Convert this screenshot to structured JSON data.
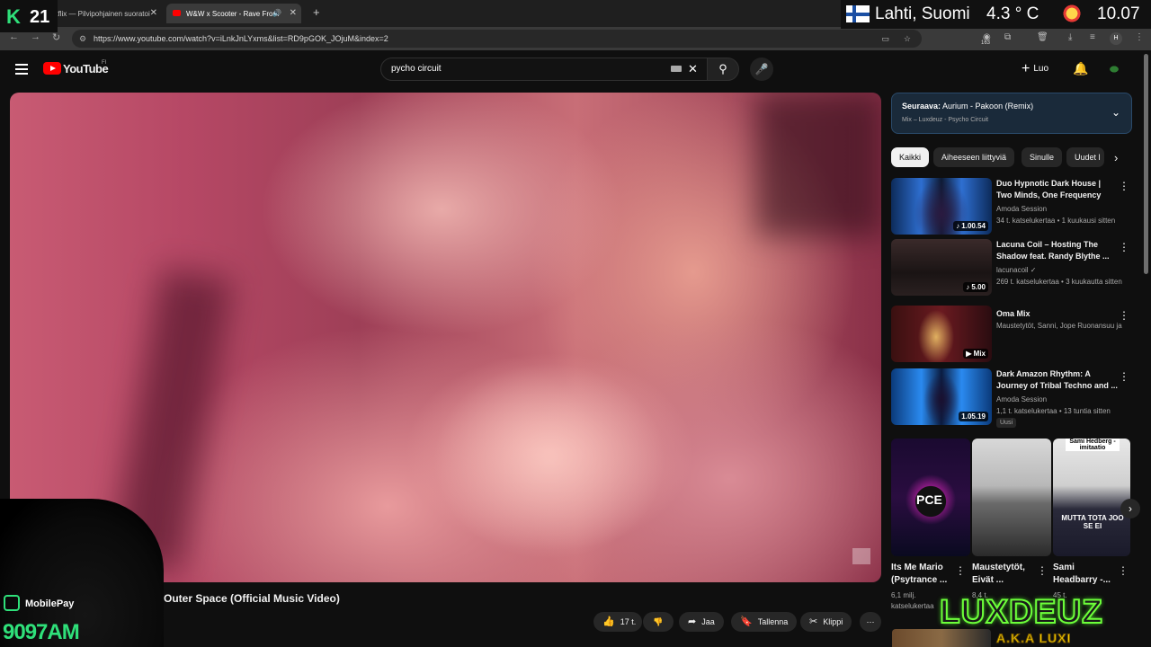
{
  "browser": {
    "tabs": [
      {
        "label": "Netflix — Pilvipohjainen suoratoi"
      },
      {
        "label": "W&W x Scooter - Rave From",
        "active": true
      }
    ],
    "new_tab": "+",
    "url": "https://www.youtube.com/watch?v=iLnkJnLYxms&list=RD9pGOK_JOjuM&index=2",
    "ext_count": "163",
    "profile_initial": "H"
  },
  "overlay": {
    "channel_logo_k": "K",
    "channel_logo_num": "21",
    "weather_city": "Lahti, Suomi",
    "weather_temp": "4.3 ° C",
    "weather_time": "10.07",
    "mobilepay_label": "MobilePay",
    "mobilepay_number": "9097AM",
    "streamer_name": "LUXDEUZ",
    "streamer_aka": "A.K.A LUXI"
  },
  "youtube": {
    "logo_text": "YouTube",
    "country": "FI",
    "search_value": "pycho circuit",
    "create_label": "Luo"
  },
  "video": {
    "title": "Outer Space (Official Music Video)",
    "actions": {
      "like": "17 t.",
      "share": "Jaa",
      "save": "Tallenna",
      "clip": "Klippi"
    }
  },
  "sidebar": {
    "up_next_prefix": "Seuraava:",
    "up_next_title": "Aurium - Pakoon (Remix)",
    "up_next_sub": "Mix – Luxdeuz - Psycho Circuit",
    "chips": [
      "Kaikki",
      "Aiheeseen liittyviä",
      "Sinulle",
      "Uudet l"
    ],
    "videos": [
      {
        "title": "Duo Hypnotic Dark House | Two Minds, One Frequency",
        "channel": "Amoda Session",
        "meta": "34 t. katselukertaa • 1 kuukausi sitten",
        "duration": "♪ 1.00.54"
      },
      {
        "title": "Lacuna Coil – Hosting The Shadow feat. Randy Blythe ...",
        "channel": "lacunacoil ✓",
        "meta": "269 t. katselukertaa • 3 kuukautta sitten",
        "duration": "♪ 5.00"
      },
      {
        "title": "Oma Mix",
        "channel": "Maustetytöt, Sanni, Jope Ruonansuu ja ...",
        "meta": "",
        "duration": "▶ Mix"
      },
      {
        "title": "Dark Amazon Rhythm: A Journey of Tribal Techno and ...",
        "channel": "Amoda Session",
        "meta": "1,1 t. katselukertaa • 13 tuntia sitten",
        "duration": "1.05.19",
        "badge": "Uusi"
      }
    ],
    "shorts": [
      {
        "title": "Its Me Mario (Psytrance ...",
        "meta1": "6,1 milj.",
        "meta2": "katselukertaa"
      },
      {
        "title": "Maustetytöt, Eivät ...",
        "meta1": "8,4 t.",
        "meta2": ""
      },
      {
        "title": "Sami Headbarry -...",
        "meta1": "45 t.",
        "meta2": ""
      }
    ],
    "short_overlay_1": "PCE",
    "short_overlay_3a": "Sami Hedberg -imitaatio",
    "short_overlay_3b": "MUTTA TOTA JOO SE EI"
  }
}
